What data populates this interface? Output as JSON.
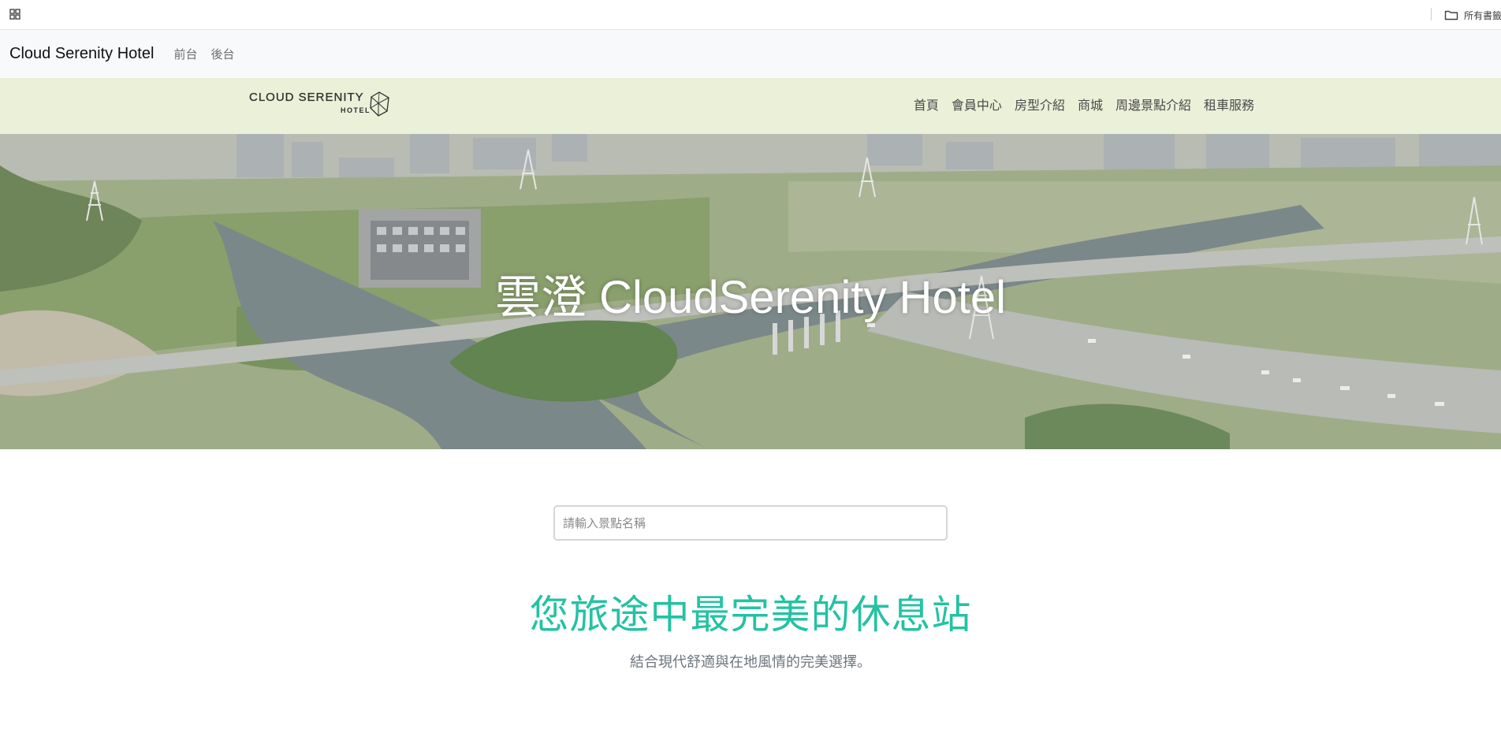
{
  "bookmarks_bar": {
    "apps_icon": "apps-grid-icon",
    "folder_icon": "folder-icon",
    "all_bookmarks_label": "所有書籤"
  },
  "top_navbar": {
    "brand": "Cloud Serenity Hotel",
    "links": [
      "前台",
      "後台"
    ]
  },
  "site_header": {
    "logo_text": "CLOUD SERENITY",
    "logo_subtext": "HOTEL",
    "nav": [
      "首頁",
      "會員中心",
      "房型介紹",
      "商城",
      "周邊景點介紹",
      "租車服務"
    ]
  },
  "hero": {
    "title": "雲澄 CloudSerenity Hotel"
  },
  "search": {
    "placeholder": "請輸入景點名稱",
    "value": ""
  },
  "main": {
    "tagline": "您旅途中最完美的休息站",
    "subtagline": "結合現代舒適與在地風情的完美選擇。"
  },
  "colors": {
    "header_bg": "#ebf0d8",
    "navbar_bg": "#f8f9fa",
    "tagline": "#24c2a3",
    "subtagline": "#6c757d"
  }
}
